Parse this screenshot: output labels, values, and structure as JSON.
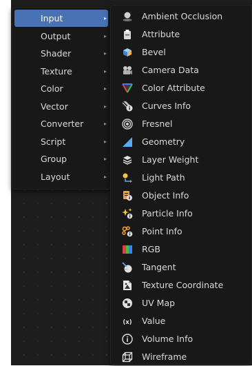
{
  "categories": [
    {
      "label": "Input",
      "active": true
    },
    {
      "label": "Output",
      "active": false
    },
    {
      "label": "Shader",
      "active": false
    },
    {
      "label": "Texture",
      "active": false
    },
    {
      "label": "Color",
      "active": false
    },
    {
      "label": "Vector",
      "active": false
    },
    {
      "label": "Converter",
      "active": false
    },
    {
      "label": "Script",
      "active": false
    },
    {
      "label": "Group",
      "active": false
    },
    {
      "label": "Layout",
      "active": false
    }
  ],
  "submenu_arrow": "▸",
  "input_nodes": [
    {
      "label": "Ambient Occlusion",
      "icon": "ambient-occlusion-icon"
    },
    {
      "label": "Attribute",
      "icon": "attribute-icon"
    },
    {
      "label": "Bevel",
      "icon": "bevel-icon"
    },
    {
      "label": "Camera Data",
      "icon": "camera-data-icon"
    },
    {
      "label": "Color Attribute",
      "icon": "color-attribute-icon"
    },
    {
      "label": "Curves Info",
      "icon": "curves-info-icon"
    },
    {
      "label": "Fresnel",
      "icon": "fresnel-icon"
    },
    {
      "label": "Geometry",
      "icon": "geometry-icon"
    },
    {
      "label": "Layer Weight",
      "icon": "layer-weight-icon"
    },
    {
      "label": "Light Path",
      "icon": "light-path-icon"
    },
    {
      "label": "Object Info",
      "icon": "object-info-icon"
    },
    {
      "label": "Particle Info",
      "icon": "particle-info-icon"
    },
    {
      "label": "Point Info",
      "icon": "point-info-icon"
    },
    {
      "label": "RGB",
      "icon": "rgb-icon"
    },
    {
      "label": "Tangent",
      "icon": "tangent-icon"
    },
    {
      "label": "Texture Coordinate",
      "icon": "texture-coordinate-icon"
    },
    {
      "label": "UV Map",
      "icon": "uv-map-icon"
    },
    {
      "label": "Value",
      "icon": "value-icon"
    },
    {
      "label": "Volume Info",
      "icon": "volume-info-icon"
    },
    {
      "label": "Wireframe",
      "icon": "wireframe-icon"
    }
  ],
  "colors": {
    "menu_background": "#181818",
    "highlight": "#4772b3",
    "text": "#d9d9d9",
    "editor_background": "#1d1d1d"
  }
}
